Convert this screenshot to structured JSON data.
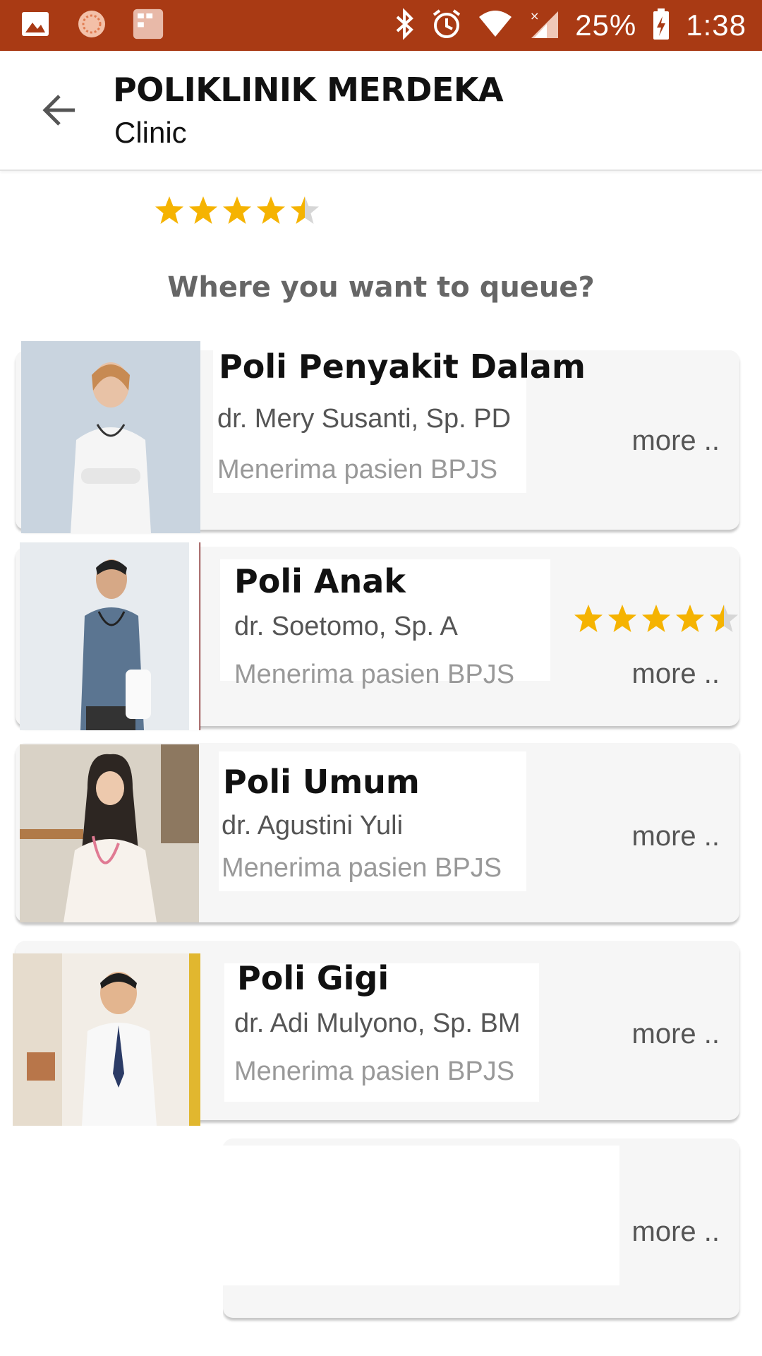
{
  "status_bar": {
    "battery": "25%",
    "time": "1:38",
    "icons": [
      "image-icon",
      "sun-icon",
      "app-grid-icon",
      "bluetooth-icon",
      "alarm-icon",
      "wifi-icon",
      "signal-icon",
      "battery-charging-icon"
    ]
  },
  "header": {
    "title": "POLIKLINIK MERDEKA",
    "subtitle": "Clinic",
    "back_icon": "arrow-left-icon"
  },
  "rating": {
    "value": 4.5,
    "max": 5
  },
  "prompt": "Where you want to queue?",
  "clinics": [
    {
      "name": "Poli Penyakit Dalam",
      "doctor": "dr. Mery Susanti, Sp. PD",
      "note": "Menerima pasien BPJS",
      "more": "more ..",
      "rating": null
    },
    {
      "name": "Poli Anak",
      "doctor": "dr. Soetomo, Sp. A",
      "note": "Menerima pasien BPJS",
      "more": "more ..",
      "rating": 4.5
    },
    {
      "name": "Poli Umum",
      "doctor": "dr. Agustini Yuli",
      "note": "Menerima pasien BPJS",
      "more": "more ..",
      "rating": null
    },
    {
      "name": "Poli Gigi",
      "doctor": "dr. Adi Mulyono, Sp. BM",
      "note": "Menerima pasien BPJS",
      "more": "more ..",
      "rating": null
    },
    {
      "name": "",
      "doctor": "",
      "note": "",
      "more": "more ..",
      "rating": null
    }
  ],
  "colors": {
    "status_bar": "#a93a14",
    "star": "#f5b301",
    "star_empty": "#d6d6d6",
    "card_bg": "#f6f6f6"
  }
}
